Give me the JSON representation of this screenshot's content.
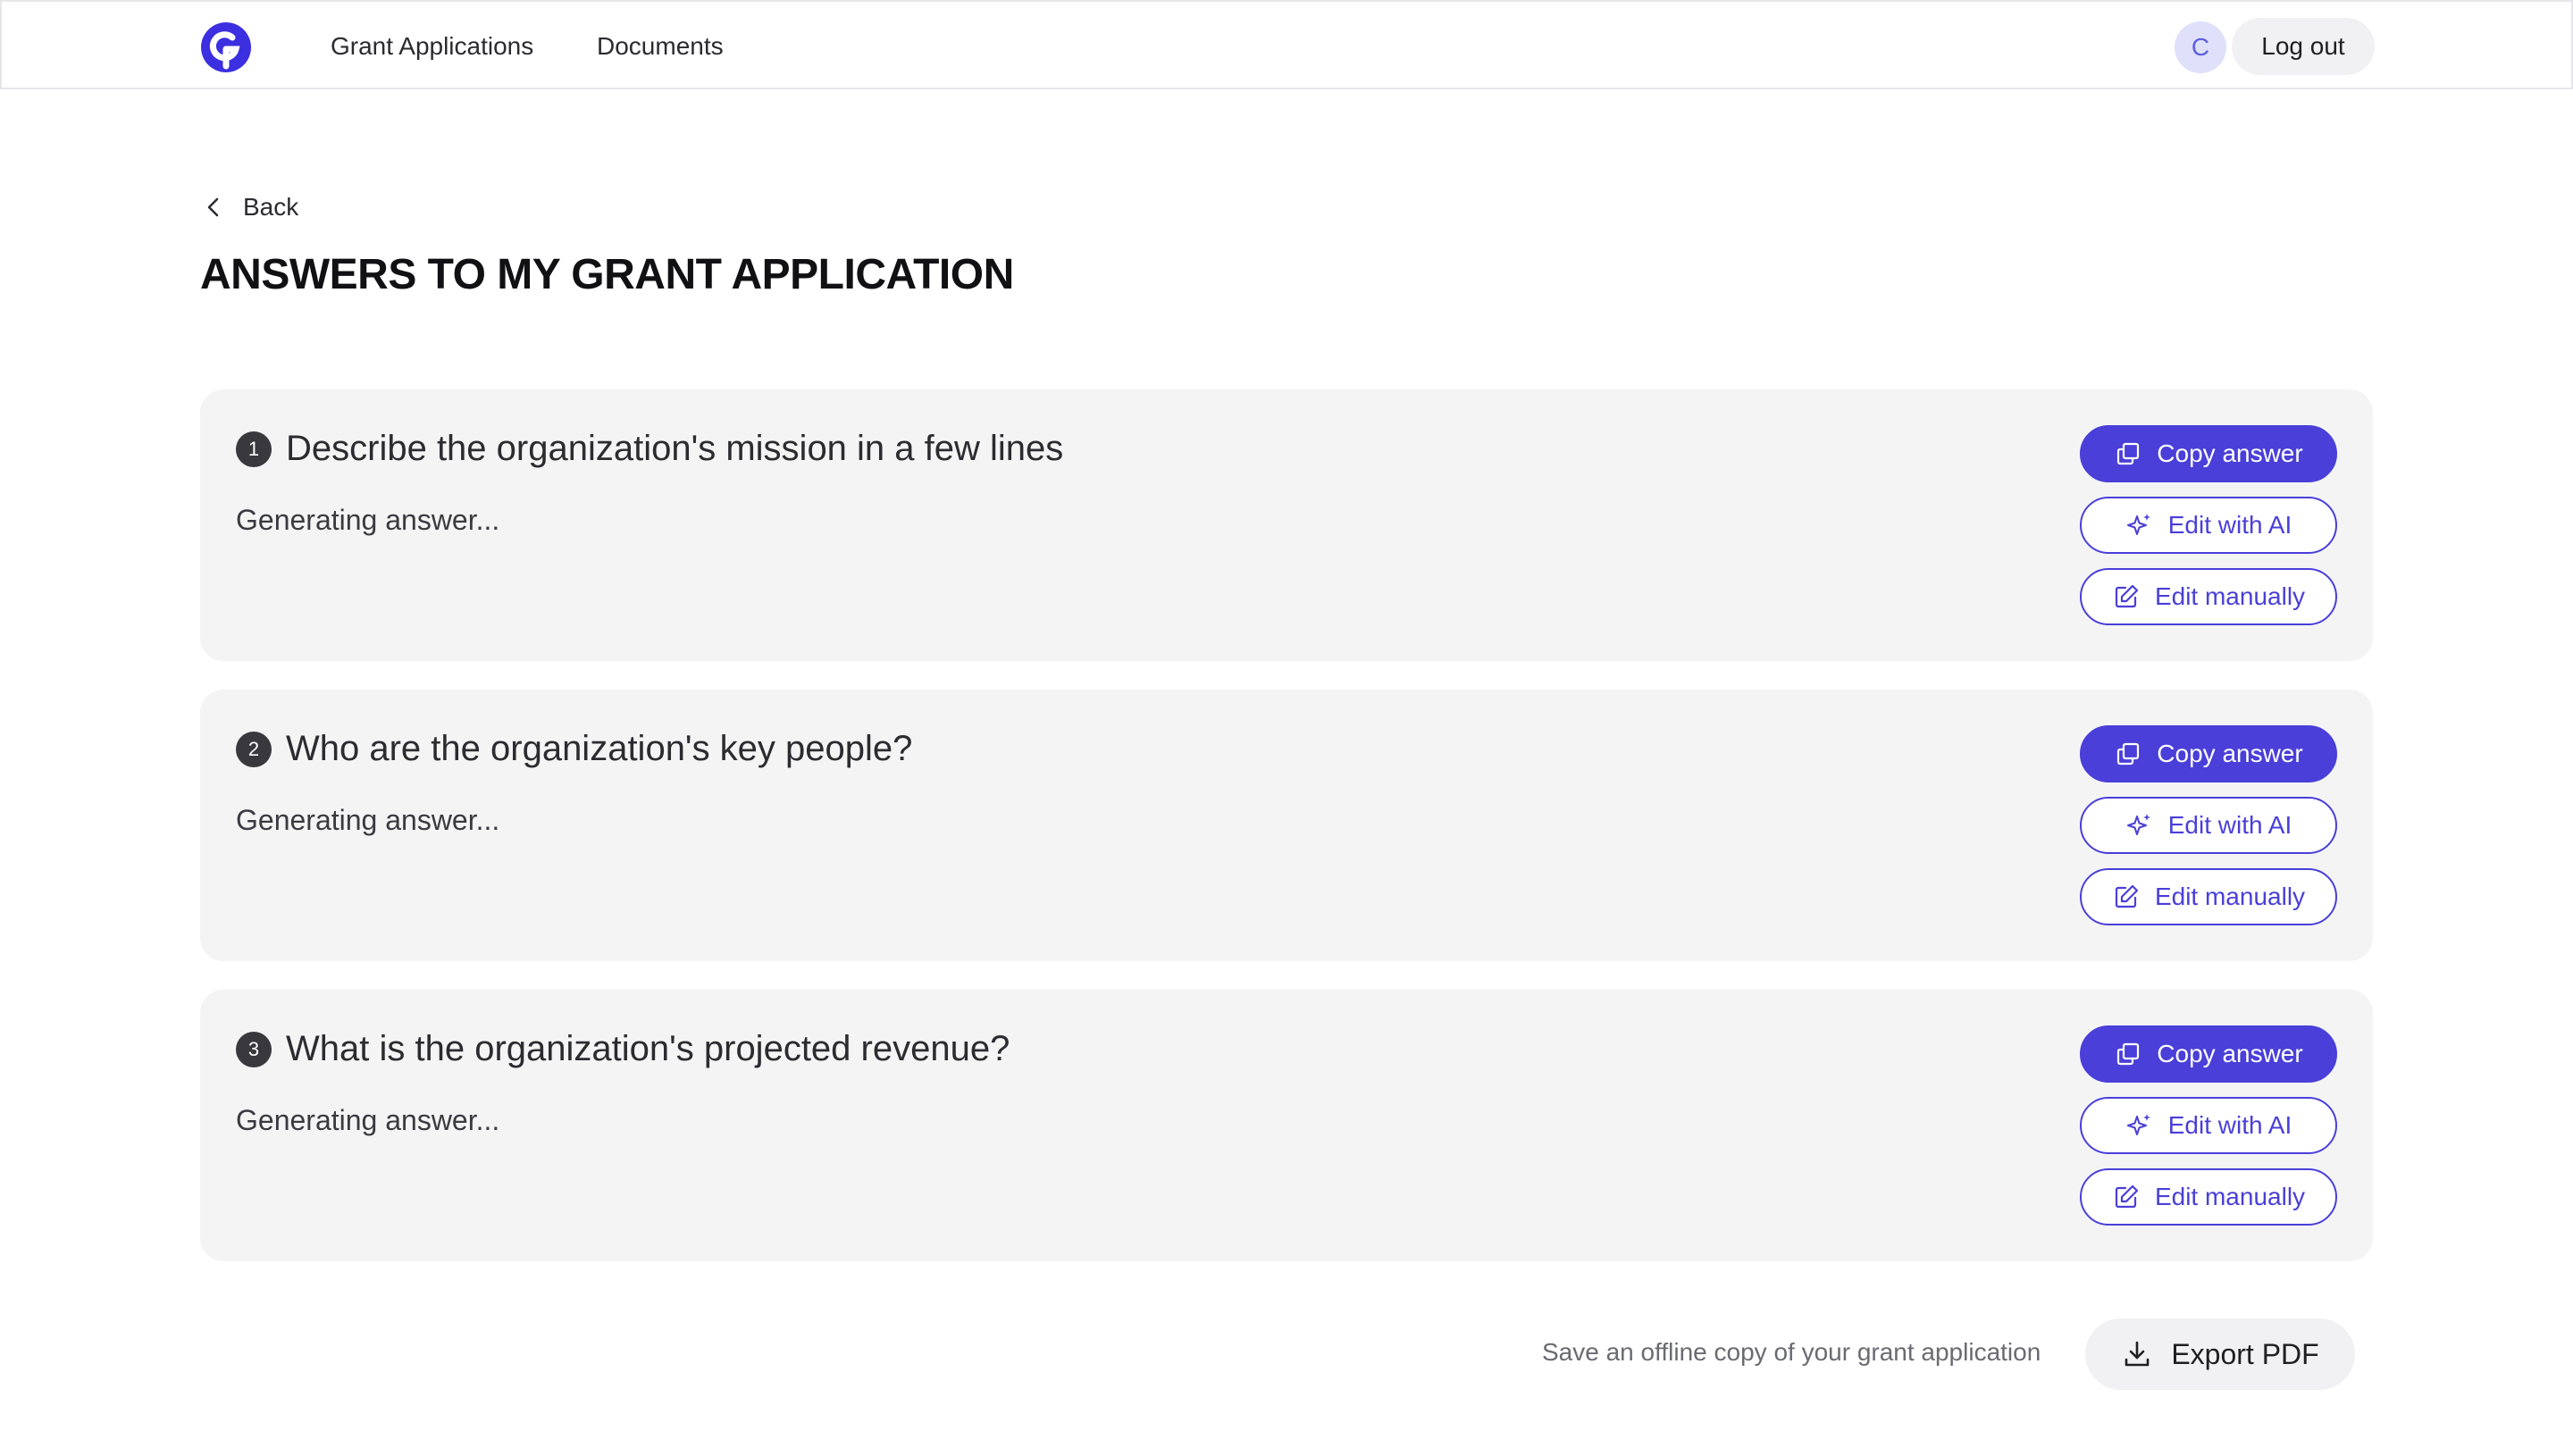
{
  "nav": {
    "links": [
      "Grant Applications",
      "Documents"
    ],
    "avatar_initial": "C",
    "logout_label": "Log out"
  },
  "header": {
    "back_label": "Back",
    "title": "ANSWERS TO MY GRANT APPLICATION"
  },
  "questions": [
    {
      "number": "1",
      "text": "Describe the organization's mission in a few lines",
      "answer": "Generating answer..."
    },
    {
      "number": "2",
      "text": "Who are the organization's key people?",
      "answer": "Generating answer..."
    },
    {
      "number": "3",
      "text": "What is the organization's projected revenue?",
      "answer": "Generating answer..."
    }
  ],
  "actions": {
    "copy_label": "Copy answer",
    "edit_ai_label": "Edit with AI",
    "edit_manual_label": "Edit manually"
  },
  "footer": {
    "export_hint": "Save an offline copy of your grant application",
    "export_label": "Export PDF"
  },
  "colors": {
    "accent": "#4a3fd8",
    "card_bg": "#f4f4f5",
    "avatar_bg": "#dfe0fa"
  },
  "icons": {
    "logo": "brand-logo-icon",
    "back": "chevron-left-icon",
    "copy": "copy-icon",
    "ai": "sparkle-icon",
    "manual": "edit-icon",
    "export": "download-icon"
  }
}
